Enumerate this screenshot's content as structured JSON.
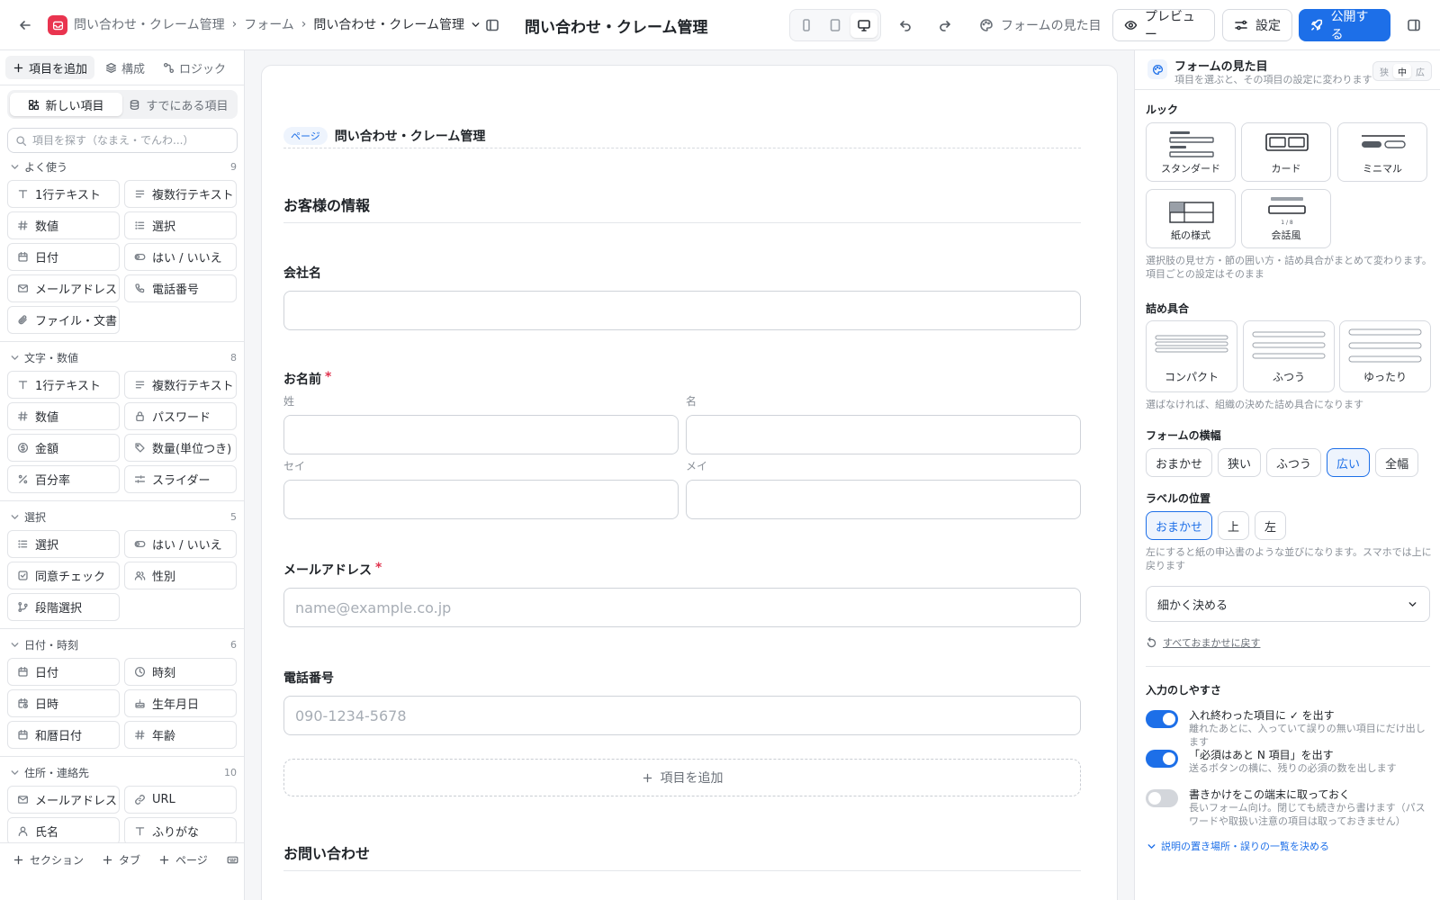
{
  "topbar": {
    "breadcrumb": [
      "問い合わせ・クレーム管理",
      "フォーム",
      "問い合わせ・クレーム管理"
    ],
    "title": "問い合わせ・クレーム管理",
    "look_label": "フォームの見た目",
    "preview_label": "プレビュー",
    "settings_label": "設定",
    "publish_label": "公開する"
  },
  "left": {
    "tabs": [
      "項目を追加",
      "構成",
      "ロジック"
    ],
    "segment": [
      "新しい項目",
      "すでにある項目"
    ],
    "search_placeholder": "項目を探す（なまえ・でんわ...）",
    "categories": [
      {
        "name": "よく使う",
        "count": "9",
        "items": [
          {
            "label": "1行テキスト",
            "icon": "text-icon"
          },
          {
            "label": "複数行テキスト",
            "icon": "multiline-icon"
          },
          {
            "label": "数値",
            "icon": "hash-icon"
          },
          {
            "label": "選択",
            "icon": "list-icon"
          },
          {
            "label": "日付",
            "icon": "calendar-icon"
          },
          {
            "label": "はい / いいえ",
            "icon": "toggle-icon"
          },
          {
            "label": "メールアドレス",
            "icon": "mail-icon"
          },
          {
            "label": "電話番号",
            "icon": "phone-icon"
          },
          {
            "label": "ファイル・文書",
            "icon": "paperclip-icon"
          }
        ]
      },
      {
        "name": "文字・数値",
        "count": "8",
        "items": [
          {
            "label": "1行テキスト",
            "icon": "text-icon"
          },
          {
            "label": "複数行テキスト",
            "icon": "multiline-icon"
          },
          {
            "label": "数値",
            "icon": "hash-icon"
          },
          {
            "label": "パスワード",
            "icon": "lock-icon"
          },
          {
            "label": "金額",
            "icon": "coin-icon"
          },
          {
            "label": "数量(単位つき)",
            "icon": "tag-icon"
          },
          {
            "label": "百分率",
            "icon": "percent-icon"
          },
          {
            "label": "スライダー",
            "icon": "slider-icon"
          }
        ]
      },
      {
        "name": "選択",
        "count": "5",
        "items": [
          {
            "label": "選択",
            "icon": "list-icon"
          },
          {
            "label": "はい / いいえ",
            "icon": "toggle-icon"
          },
          {
            "label": "同意チェック",
            "icon": "checkbox-icon"
          },
          {
            "label": "性別",
            "icon": "users-icon"
          },
          {
            "label": "段階選択",
            "icon": "branch-icon"
          }
        ]
      },
      {
        "name": "日付・時刻",
        "count": "6",
        "items": [
          {
            "label": "日付",
            "icon": "calendar-icon"
          },
          {
            "label": "時刻",
            "icon": "clock-icon"
          },
          {
            "label": "日時",
            "icon": "calendar-clock-icon"
          },
          {
            "label": "生年月日",
            "icon": "cake-icon"
          },
          {
            "label": "和暦日付",
            "icon": "calendar-icon"
          },
          {
            "label": "年齢",
            "icon": "hash-icon"
          }
        ]
      },
      {
        "name": "住所・連絡先",
        "count": "10",
        "items": [
          {
            "label": "メールアドレス",
            "icon": "mail-icon"
          },
          {
            "label": "URL",
            "icon": "link-icon"
          },
          {
            "label": "氏名",
            "icon": "user-icon"
          },
          {
            "label": "ふりがな",
            "icon": "text-icon"
          }
        ]
      }
    ],
    "footer": [
      "セクション",
      "タブ",
      "ページ"
    ]
  },
  "canvas": {
    "page_tag": "ページ",
    "page_name": "問い合わせ・クレーム管理",
    "section1": "お客様の情報",
    "company_label": "会社名",
    "name_label": "お名前",
    "sei_label": "姓",
    "mei_label": "名",
    "sei_kana_label": "セイ",
    "mei_kana_label": "メイ",
    "email_label": "メールアドレス",
    "email_placeholder": "name@example.co.jp",
    "phone_label": "電話番号",
    "phone_placeholder": "090-1234-5678",
    "required_mark": "*",
    "add_field_label": "項目を追加",
    "section2": "お問い合わせ"
  },
  "right": {
    "title": "フォームの見た目",
    "subtitle": "項目を選ぶと、その項目の設定に変わります",
    "density_mini": [
      "狭",
      "中",
      "広"
    ],
    "look_heading": "ルック",
    "looks": [
      "スタンダード",
      "カード",
      "ミニマル",
      "紙の様式",
      "会話風"
    ],
    "conv_progress": "1 / 8",
    "look_note": "選択肢の見せ方・節の囲い方・詰め具合がまとめて変わります。項目ごとの設定はそのまま",
    "density_heading": "詰め具合",
    "densities": [
      "コンパクト",
      "ふつう",
      "ゆったり"
    ],
    "density_note": "選ばなければ、組織の決めた詰め具合になります",
    "width_heading": "フォームの横幅",
    "widths": [
      "おまかせ",
      "狭い",
      "ふつう",
      "広い",
      "全幅"
    ],
    "label_heading": "ラベルの位置",
    "label_positions": [
      "おまかせ",
      "上",
      "左"
    ],
    "label_note": "左にすると紙の申込書のような並びになります。スマホでは上に戻ります",
    "fine_tune": "細かく決める",
    "reset": "すべておまかせに戻す",
    "ease_heading": "入力のしやすさ",
    "toggles": [
      {
        "title": "入れ終わった項目に ✓ を出す",
        "desc": "離れたあとに、入っていて誤りの無い項目にだけ出します"
      },
      {
        "title": "「必須はあと N 項目」を出す",
        "desc": "送るボタンの横に、残りの必須の数を出します"
      },
      {
        "title": "書きかけをこの端末に取っておく",
        "desc": "長いフォーム向け。閉じても続きから書けます（パスワードや取扱い注意の項目は取っておきません）"
      }
    ],
    "expand_link": "説明の置き場所・誤りの一覧を決める"
  },
  "colors": {
    "accent": "#1d6fe8",
    "brand": "#e9344f",
    "required": "#e0344f"
  }
}
